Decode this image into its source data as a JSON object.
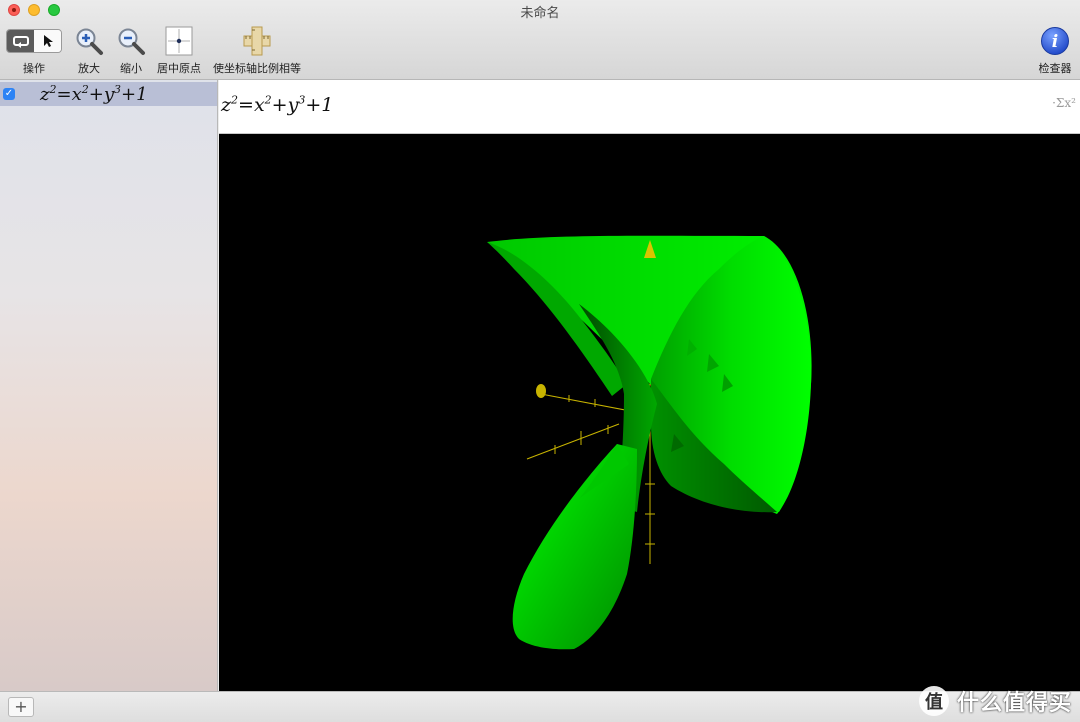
{
  "window": {
    "title": "未命名"
  },
  "toolbar": {
    "operate_label": "操作",
    "zoom_in_label": "放大",
    "zoom_out_label": "缩小",
    "center_origin_label": "居中原点",
    "equal_axes_label": "使坐标轴比例相等",
    "inspector_label": "检查器"
  },
  "sidebar": {
    "equations": [
      {
        "checked": true,
        "base_z": "z",
        "exp_z": "2",
        "eq": "=",
        "base_x": "x",
        "exp_x": "2",
        "plus1": "+",
        "base_y": "y",
        "exp_y": "3",
        "tail": "+1"
      }
    ]
  },
  "editor": {
    "equation": {
      "base_z": "z",
      "exp_z": "2",
      "eq": "=",
      "base_x": "x",
      "exp_x": "2",
      "plus1": "+",
      "base_y": "y",
      "exp_y": "3",
      "tail": "+1"
    },
    "math_palette_glyph": "·Σx²"
  },
  "bottom_bar": {
    "add_glyph": "+"
  },
  "watermark": {
    "text": "什么值得买"
  },
  "graph": {
    "surface_color": "#00e600",
    "axis_color": "#c8b400",
    "background": "#000000"
  },
  "icons": [
    "rotate-icon",
    "pointer-icon",
    "zoom-in-icon",
    "zoom-out-icon",
    "center-origin-icon",
    "equal-axes-icon",
    "info-icon",
    "checkbox-icon",
    "watermark-logo-icon"
  ]
}
